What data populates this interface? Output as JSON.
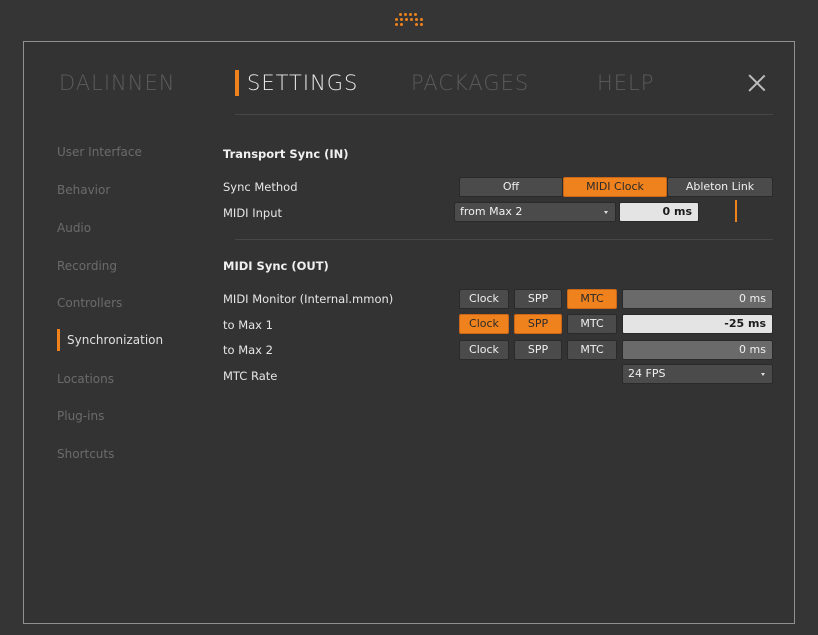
{
  "tabs": [
    "DALINNEN",
    "SETTINGS",
    "PACKAGES",
    "HELP"
  ],
  "sidebar": {
    "items": [
      "User Interface",
      "Behavior",
      "Audio",
      "Recording",
      "Controllers",
      "Synchronization",
      "Locations",
      "Plug-ins",
      "Shortcuts"
    ],
    "active": "Synchronization"
  },
  "transport_in": {
    "header": "Transport Sync (IN)",
    "sync_method_label": "Sync Method",
    "sync_options": [
      "Off",
      "MIDI Clock",
      "Ableton Link"
    ],
    "sync_selected": "MIDI Clock",
    "midi_input_label": "MIDI Input",
    "midi_input_value": "from Max 2",
    "midi_input_offset": "0 ms"
  },
  "midi_out": {
    "header": "MIDI Sync (OUT)",
    "rows": [
      {
        "label": "MIDI Monitor (Internal.mmon)",
        "clock": "Clock",
        "spp": "SPP",
        "mtc": "MTC",
        "offset": "0 ms"
      },
      {
        "label": "to Max 1",
        "clock": "Clock",
        "spp": "SPP",
        "mtc": "MTC",
        "offset": "-25 ms"
      },
      {
        "label": "to Max 2",
        "clock": "Clock",
        "spp": "SPP",
        "mtc": "MTC",
        "offset": "0 ms"
      }
    ],
    "mtc_rate_label": "MTC Rate",
    "mtc_rate_value": "24 FPS"
  },
  "colors": {
    "accent": "#f0821e",
    "background": "#353535"
  },
  "icons": {
    "logo": "bitwig-logo-icon",
    "close": "close-icon"
  }
}
